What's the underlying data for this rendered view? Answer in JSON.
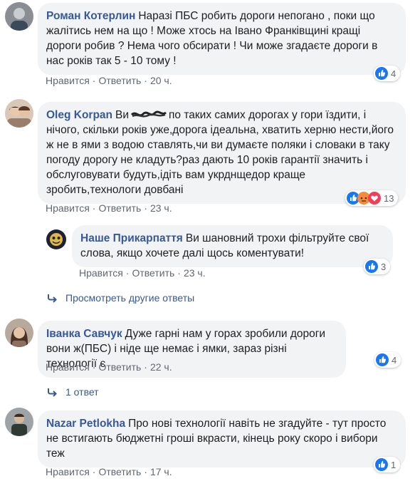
{
  "colors": {
    "accent": "#385898",
    "bubble": "#f2f3f5",
    "meta": "#606770",
    "like_blue": "#1877f2"
  },
  "labels": {
    "like": "Нравится",
    "reply": "Ответить"
  },
  "comments": [
    {
      "author": "Роман Котерлин",
      "text": "Наразі ПБС робить дороги непогано , поки що жалітись нем на що ! Може хтось на Івано Франківщині кращі дороги робив ? Нема чого обсирати ! Чи може згадаєте дороги в нас років так 5 - 10 тому !",
      "time": "20 ч.",
      "reactions": [
        "like-icon"
      ],
      "reaction_count": "4"
    },
    {
      "author": "Oleg Korpan",
      "text_before": "Ви",
      "text_after": "по таких самих дорогах у гори їздити, і нічого, скільки років уже,дорога ідеальна, хватить херню нести,його ж не в ями з водою ставлять,чи ви думаєте поляки і словаки в таку погоду дорогу не кладуть?раз дають 10 років гарантії значить і обслуговувати будуть,ідіть вам укрднщедор краще зробить,технологи довбані",
      "time": "23 ч.",
      "reactions": [
        "like-icon",
        "angry-icon",
        "love-icon"
      ],
      "reaction_count": "13"
    },
    {
      "author": "Наше Прикарпаття",
      "text": "Ви шановний трохи фільтруйте свої слова, якщо хочете далі щось коментувати!",
      "time": "23 ч.",
      "reactions": [
        "like-icon"
      ],
      "reaction_count": "3"
    },
    {
      "author": "Іванка Савчук",
      "text": "Дуже гарні нам у горах зробили дороги вони ж(ПБС) і ніде ще немає і ямки, зараз різні технології є",
      "time": "22 ч.",
      "reactions": [
        "like-icon"
      ],
      "reaction_count": "4"
    },
    {
      "author": "Nazar Petlokha",
      "text": "Про нові технології навіть не згадуйте - тут просто не встигають бюджетні гроші вкрасти, кінець року скоро і вибори теж",
      "time": "17 ч.",
      "reactions": [
        "like-icon"
      ],
      "reaction_count": "1"
    }
  ],
  "more_replies": "Просмотреть другие ответы",
  "one_reply": "1 ответ"
}
